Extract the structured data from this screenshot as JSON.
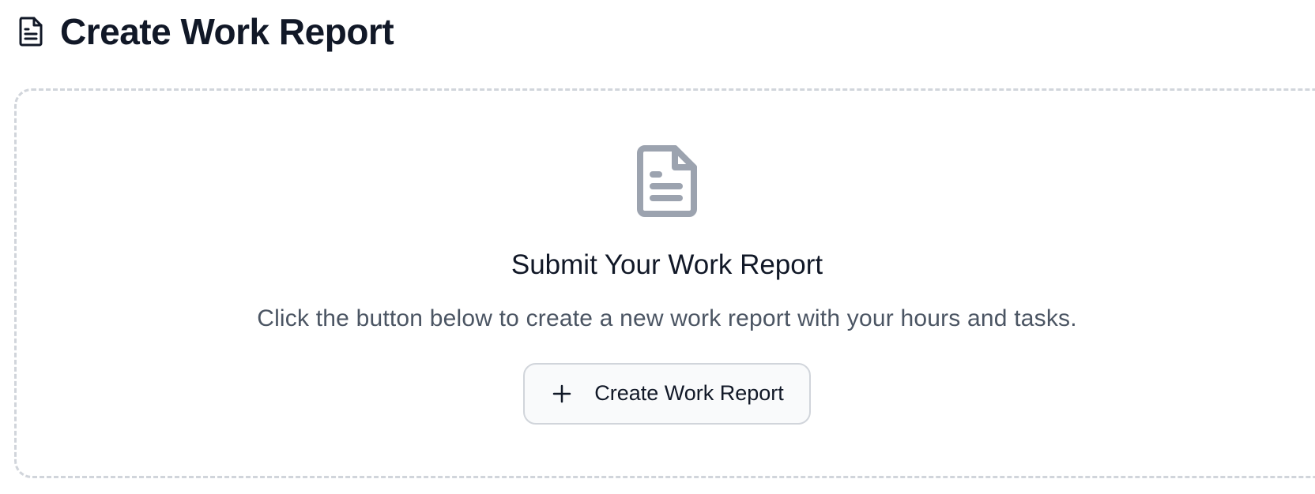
{
  "header": {
    "icon": "document-icon",
    "title": "Create Work Report"
  },
  "empty_state": {
    "icon": "document-icon",
    "heading": "Submit Your Work Report",
    "description": "Click the button below to create a new work report with your hours and tasks.",
    "button": {
      "icon": "plus-icon",
      "label": "Create Work Report"
    }
  },
  "colors": {
    "text_primary": "#111827",
    "text_secondary": "#4b5563",
    "icon_muted": "#9ca3af",
    "border_dashed": "#d1d5db",
    "button_bg": "#f9fafb"
  }
}
